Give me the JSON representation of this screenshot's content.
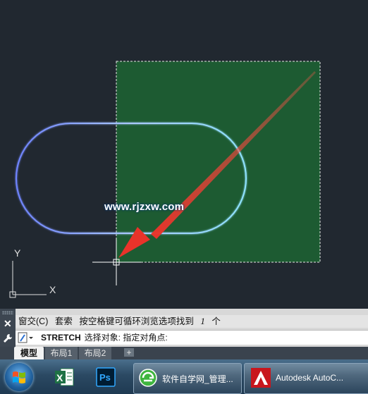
{
  "watermark": "www.rjzxw.com",
  "command": {
    "history": {
      "prefix": "窗交(C)",
      "word1": "套索",
      "message": "按空格键可循环浏览选项找到",
      "count": "1",
      "unit": "个"
    },
    "current": {
      "keyword": "STRETCH",
      "prompt": "选择对象: 指定对角点:"
    }
  },
  "layout_tabs": [
    "模型",
    "布局1",
    "布局2"
  ],
  "layout_add": "+",
  "taskbar": {
    "apps": [
      {
        "name": "excel-icon"
      },
      {
        "name": "photoshop-icon",
        "label": "Ps"
      },
      {
        "name": "browser-icon",
        "label": "软件自学网_管理..."
      },
      {
        "name": "autocad-icon",
        "label": "Autodesk AutoC..."
      }
    ]
  },
  "colors": {
    "canvas_bg": "#212830",
    "selection_fill": "#1d5b32",
    "arrow": "#e8332a",
    "shape_stroke": "#9fc7ff"
  },
  "ucs": {
    "x_label": "X",
    "y_label": "Y"
  }
}
